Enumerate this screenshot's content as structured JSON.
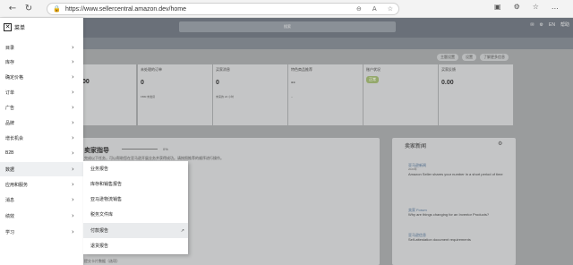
{
  "browser": {
    "url": "https://www.sellercentral.amazon.dev/home",
    "lock_icon": "lock-icon",
    "nav_icons": [
      "back-icon",
      "refresh-icon"
    ]
  },
  "header": {
    "search_text": "搜索",
    "right_items": [
      "EN",
      "帮助"
    ]
  },
  "toolbar": {
    "buttons": [
      "主题设置",
      "设置",
      "了解更多信息"
    ]
  },
  "cards": [
    {
      "title": "",
      "value": ".00",
      "sub": ""
    },
    {
      "title": "未处理的订单",
      "value": "0",
      "sub": "FBM 未发货"
    },
    {
      "title": "买家消息",
      "value": "0",
      "sub": "未来的 24 小时"
    },
    {
      "title": "特色商品推荐",
      "value": "--",
      "sub": "--"
    },
    {
      "title": "账户状况",
      "value": "",
      "badge": "正常",
      "sub": ""
    },
    {
      "title": "买家反馈",
      "value": "0.00",
      "sub": ""
    }
  ],
  "guide": {
    "title": "卖家指导",
    "pct": "0%",
    "desc": "完成以下任务，可以帮助您在亚马逊开展业务并获得成功。请按照推荐的顺序进行操作。",
    "bottom": "提交卡片数据（选项）"
  },
  "news": {
    "title": "卖家新闻",
    "items": [
      {
        "link": "亚马逊新闻",
        "date": "2023年",
        "text": "Amazon Seller shares your number in a short period of time"
      },
      {
        "link": "卖家 Forum",
        "date": "",
        "text": "Why are things changing for an Inventor Products?"
      },
      {
        "link": "亚马逊信息",
        "date": "",
        "text": "Self-attestation document requirements"
      }
    ]
  },
  "menu": {
    "title": "菜单",
    "items": [
      {
        "label": "目录",
        "active": false
      },
      {
        "label": "库存",
        "active": false
      },
      {
        "label": "确定价格",
        "active": false
      },
      {
        "label": "订单",
        "active": false
      },
      {
        "label": "广告",
        "active": false
      },
      {
        "label": "品牌",
        "active": false
      },
      {
        "label": "增长机会",
        "active": false
      },
      {
        "label": "B2B",
        "active": false
      },
      {
        "label": "数据",
        "active": true
      },
      {
        "label": "应用和服务",
        "active": false
      },
      {
        "label": "消息",
        "active": false
      },
      {
        "label": "绩效",
        "active": false
      },
      {
        "label": "学习",
        "active": false
      }
    ]
  },
  "submenu": {
    "items": [
      {
        "label": "业务报告",
        "hover": false,
        "ext": ""
      },
      {
        "label": "库存和销售报告",
        "hover": false,
        "ext": ""
      },
      {
        "label": "亚马逊物流销售",
        "hover": false,
        "ext": ""
      },
      {
        "label": "税务文件库",
        "hover": false,
        "ext": ""
      },
      {
        "label": "付款报告",
        "hover": true,
        "ext": "↗"
      },
      {
        "label": "退货报告",
        "hover": false,
        "ext": ""
      }
    ]
  }
}
